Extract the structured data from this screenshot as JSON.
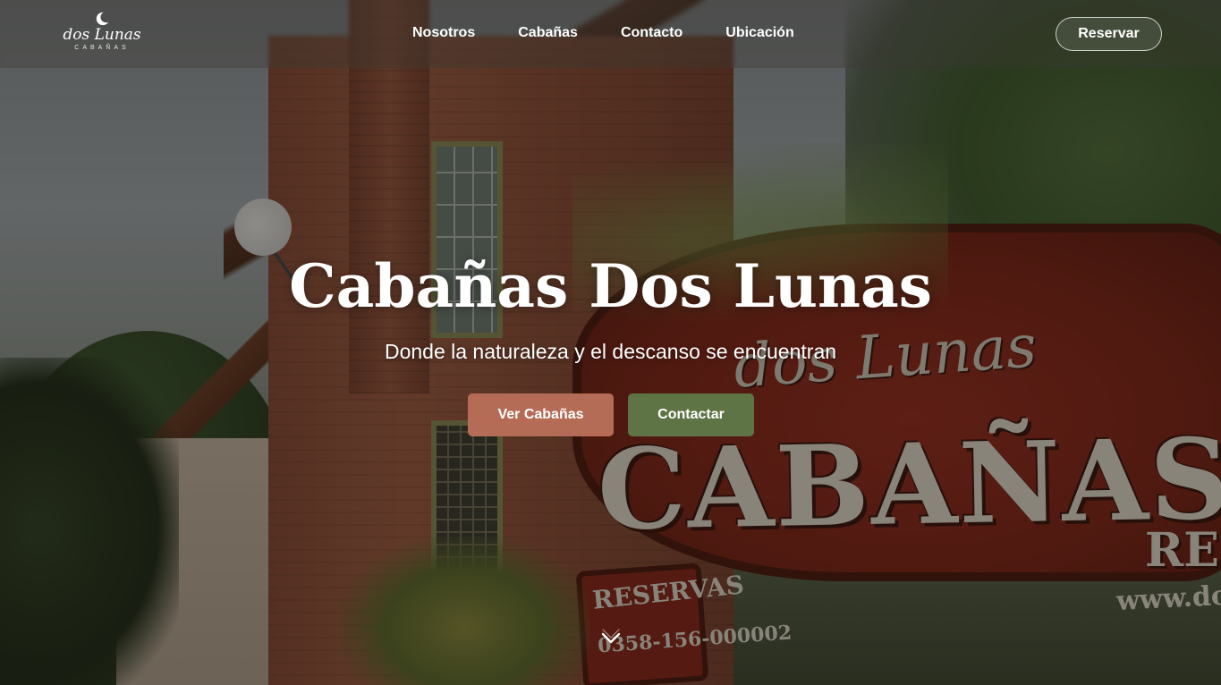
{
  "brand": {
    "logo_script": "dos Lunas",
    "logo_sub": "CABAÑAS"
  },
  "nav": {
    "links": [
      {
        "label": "Nosotros"
      },
      {
        "label": "Cabañas"
      },
      {
        "label": "Contacto"
      },
      {
        "label": "Ubicación"
      }
    ],
    "reserve_label": "Reservar"
  },
  "hero": {
    "title": "Cabañas Dos Lunas",
    "subtitle": "Donde la naturaleza y el descanso se encuentran",
    "primary_button": "Ver Cabañas",
    "secondary_button": "Contactar",
    "scroll_icon": "chevron-down-icon"
  },
  "background_photo": {
    "sign_main": "CABAÑAS",
    "sign_script": "dos Lunas",
    "sign_res": "RES",
    "sign_web": "www.doslun",
    "small_sign_line1": "RESERVAS",
    "small_sign_line2": "0358-156-000002"
  },
  "colors": {
    "primary_button": "#b46c56",
    "secondary_button": "#5f7444",
    "text": "#ffffff"
  }
}
